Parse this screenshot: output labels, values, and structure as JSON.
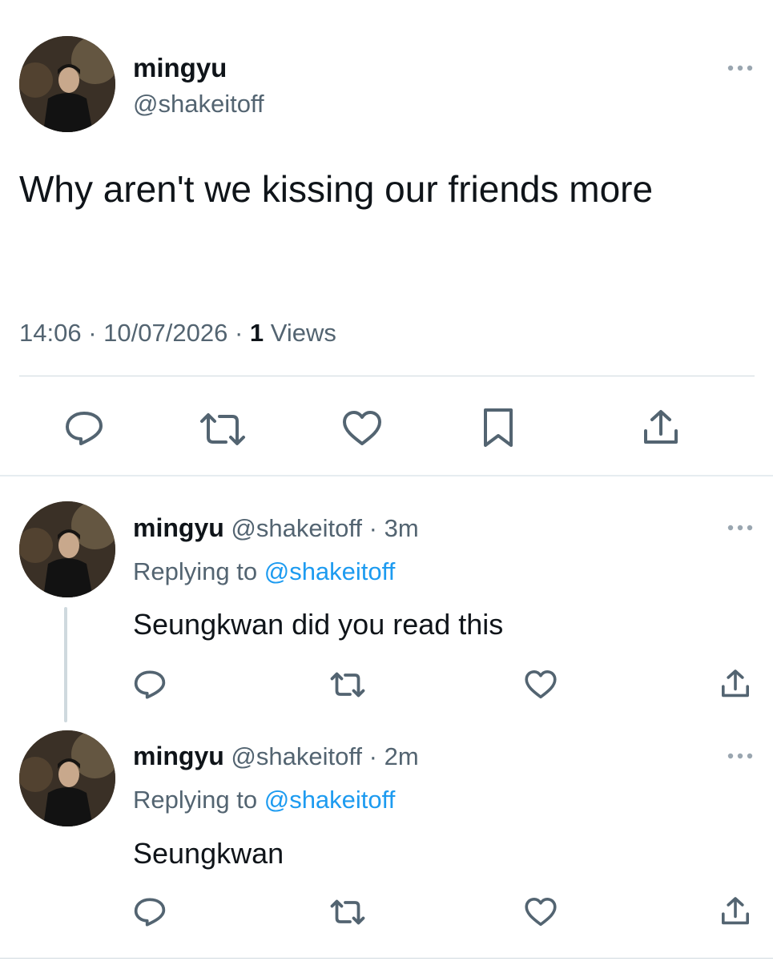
{
  "main_tweet": {
    "display_name": "mingyu",
    "handle": "@shakeitoff",
    "text": "Why aren't we kissing our friends more",
    "time": "14:06",
    "date": "10/07/2026",
    "sep": "·",
    "views_count": "1",
    "views_label": "Views",
    "actions": [
      "reply-icon",
      "retweet-icon",
      "like-icon",
      "bookmark-icon",
      "share-icon"
    ]
  },
  "replies": [
    {
      "display_name": "mingyu",
      "handle": "@shakeitoff",
      "sep": "·",
      "age": "3m",
      "replying_prefix": "Replying to",
      "replying_handle": "@shakeitoff",
      "text": "Seungkwan did you read this",
      "actions": [
        "reply-icon",
        "retweet-icon",
        "like-icon",
        "share-icon"
      ]
    },
    {
      "display_name": "mingyu",
      "handle": "@shakeitoff",
      "sep": "·",
      "age": "2m",
      "replying_prefix": "Replying to",
      "replying_handle": "@shakeitoff",
      "text": "Seungkwan",
      "actions": [
        "reply-icon",
        "retweet-icon",
        "like-icon",
        "share-icon"
      ]
    }
  ],
  "colors": {
    "text": "#0f1419",
    "secondary": "#536471",
    "link": "#1d9bf0",
    "divider": "#cfd9de"
  }
}
